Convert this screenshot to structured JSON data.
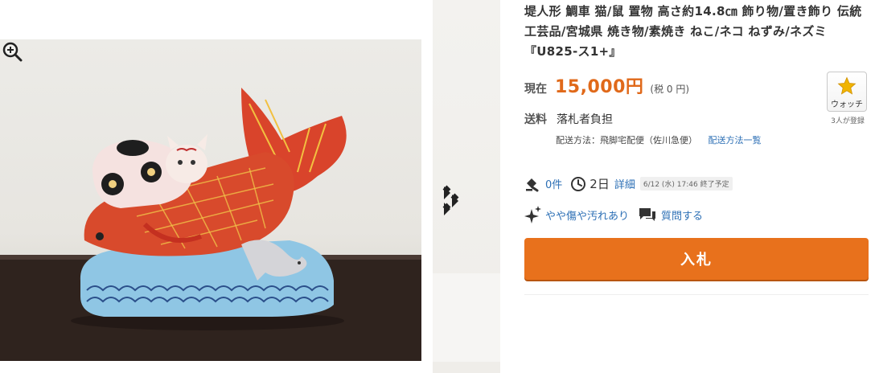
{
  "item": {
    "title": "堤人形 鯛車 猫/鼠 置物 高さ約14.8㎝ 飾り物/置き飾り 伝統工芸品/宮城県 焼き物/素焼き ねこ/ネコ ねずみ/ネズミ『U825-ス1+』"
  },
  "price": {
    "label": "現在",
    "value": "15,000円",
    "tax": "(税 0 円)"
  },
  "watch": {
    "label": "ウォッチ",
    "count": "3人が登録",
    "icon": "star-icon"
  },
  "shipping": {
    "label": "送料",
    "value": "落札者負担",
    "method": "配送方法：飛脚宅配便（佐川急便）",
    "method_link": "配送方法一覧"
  },
  "meta": {
    "bids": "0件",
    "time_left": "2日",
    "detail_link": "詳細",
    "end_date": "6/12 (水) 17:46 終了予定"
  },
  "links": {
    "condition": "やや傷や汚れあり",
    "question": "質問する"
  },
  "bid_button": {
    "label": "入札"
  },
  "colors": {
    "accent": "#e8711c",
    "price": "#e0691a",
    "link": "#2c6fb5",
    "star": "#f0b400"
  },
  "icons": [
    "zoom-in-icon",
    "next-arrow-icon",
    "gavel-icon",
    "clock-icon",
    "sparkle-icon",
    "chat-icon",
    "star-icon"
  ]
}
